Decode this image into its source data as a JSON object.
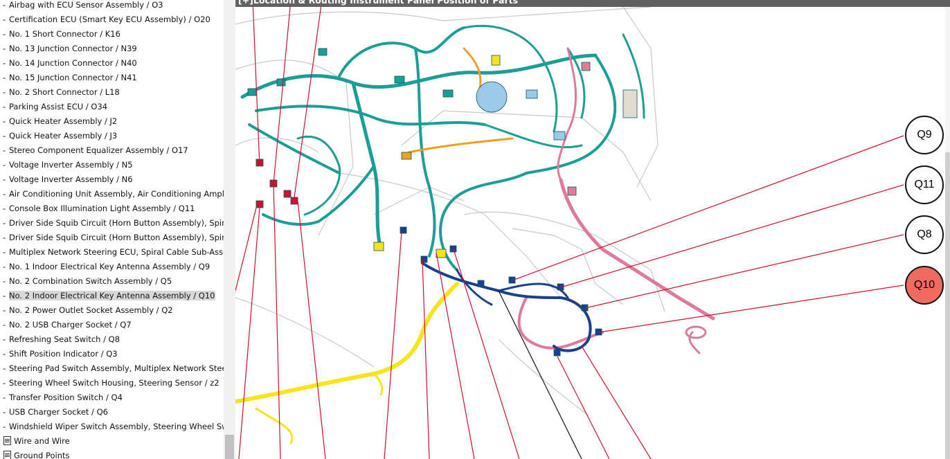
{
  "header": {
    "title": "[+]Location & Routing  Instrument Panel  Position of Parts"
  },
  "tree": {
    "items": [
      {
        "label": "Airbag with ECU Sensor Assembly / O3"
      },
      {
        "label": "Certification ECU (Smart Key ECU Assembly) / O20"
      },
      {
        "label": "No. 1 Short Connector / K16"
      },
      {
        "label": "No. 13 Junction Connector / N39"
      },
      {
        "label": "No. 14 Junction Connector / N40"
      },
      {
        "label": "No. 15 Junction Connector / N41"
      },
      {
        "label": "No. 2 Short Connector / L18"
      },
      {
        "label": "Parking Assist ECU / O34"
      },
      {
        "label": "Quick Heater Assembly / J2"
      },
      {
        "label": "Quick Heater Assembly / J3"
      },
      {
        "label": "Stereo Component Equalizer Assembly / O17"
      },
      {
        "label": "Voltage Inverter Assembly / N5"
      },
      {
        "label": "Voltage Inverter Assembly / N6"
      },
      {
        "label": "Air Conditioning Unit Assembly, Air Conditioning Amplifi"
      },
      {
        "label": "Console Box Illumination Light Assembly / Q11"
      },
      {
        "label": "Driver Side Squib Circuit (Horn Button Assembly), Spira"
      },
      {
        "label": "Driver Side Squib Circuit (Horn Button Assembly), Spira"
      },
      {
        "label": "Multiplex Network Steering ECU, Spiral Cable Sub-Asser"
      },
      {
        "label": "No. 1 Indoor Electrical Key Antenna Assembly / Q9"
      },
      {
        "label": "No. 2 Combination Switch Assembly / Q5"
      },
      {
        "label": "No. 2 Indoor Electrical Key Antenna Assembly / Q10",
        "selected": true
      },
      {
        "label": "No. 2 Power Outlet Socket Assembly / Q2"
      },
      {
        "label": "No. 2 USB Charger Socket / Q7"
      },
      {
        "label": "Refreshing Seat Switch / Q8"
      },
      {
        "label": "Shift Position Indicator / Q3"
      },
      {
        "label": "Steering Pad Switch Assembly, Multiplex Network Steeri"
      },
      {
        "label": "Steering Wheel Switch Housing, Steering Sensor / z2"
      },
      {
        "label": "Transfer Position Switch / Q4"
      },
      {
        "label": "USB Charger Socket / Q6"
      },
      {
        "label": "Windshield Wiper Switch Assembly, Steering Wheel Swi"
      }
    ],
    "folders": [
      {
        "label": "Wire and Wire",
        "icon": "document-icon"
      },
      {
        "label": "Ground Points",
        "icon": "document-icon"
      }
    ]
  },
  "diagram": {
    "callouts": [
      {
        "label": "Q9",
        "highlighted": false
      },
      {
        "label": "Q11",
        "highlighted": false
      },
      {
        "label": "Q8",
        "highlighted": false
      },
      {
        "label": "Q10",
        "highlighted": true
      }
    ],
    "colors": {
      "teal_harness": "#1a9e96",
      "blue_harness": "#1a3f8f",
      "pink_harness": "#e07a9a",
      "yellow_harness": "#f5e51a",
      "orange_harness": "#f0a020",
      "red_connector": "#d01030",
      "leader_line": "#d0102a",
      "highlight_fill": "#f06a62"
    }
  }
}
